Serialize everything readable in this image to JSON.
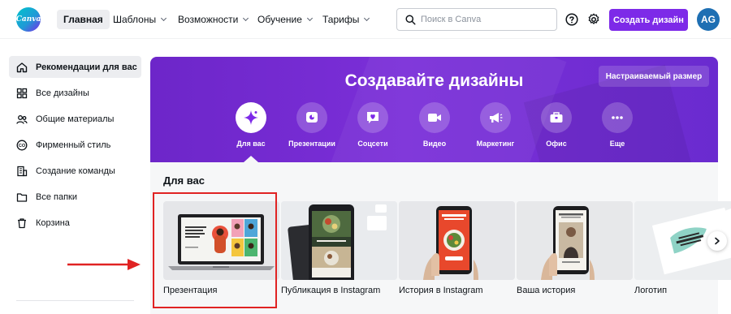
{
  "header": {
    "logo_text": "Canva",
    "nav": [
      {
        "label": "Главная",
        "active": true
      },
      {
        "label": "Шаблоны"
      },
      {
        "label": "Возможности"
      },
      {
        "label": "Обучение"
      },
      {
        "label": "Тарифы"
      }
    ],
    "search_placeholder": "Поиск в Canva",
    "help_icon": "question-circle-icon",
    "settings_icon": "gear-icon",
    "create_button": "Создать дизайн",
    "avatar_initials": "AG"
  },
  "sidebar": {
    "items": [
      {
        "label": "Рекомендации для вас",
        "icon": "home-icon",
        "active": true
      },
      {
        "label": "Все дизайны",
        "icon": "grid-icon"
      },
      {
        "label": "Общие материалы",
        "icon": "people-icon"
      },
      {
        "label": "Фирменный стиль",
        "icon": "brand-icon"
      },
      {
        "label": "Создание команды",
        "icon": "building-icon"
      },
      {
        "label": "Все папки",
        "icon": "folder-icon"
      },
      {
        "label": "Корзина",
        "icon": "trash-icon"
      }
    ]
  },
  "hero": {
    "title": "Создавайте дизайны",
    "custom_size_button": "Настраиваемый размер",
    "categories": [
      {
        "label": "Для вас",
        "icon": "sparkle-icon",
        "active": true
      },
      {
        "label": "Презентации",
        "icon": "presentation-icon"
      },
      {
        "label": "Соцсети",
        "icon": "heart-chat-icon"
      },
      {
        "label": "Видео",
        "icon": "video-camera-icon"
      },
      {
        "label": "Маркетинг",
        "icon": "megaphone-icon"
      },
      {
        "label": "Офис",
        "icon": "briefcase-icon"
      },
      {
        "label": "Еще",
        "icon": "more-dots-icon"
      }
    ]
  },
  "section": {
    "title": "Для вас",
    "cards": [
      {
        "label": "Презентация"
      },
      {
        "label": "Публикация в Instagram"
      },
      {
        "label": "История в Instagram"
      },
      {
        "label": "Ваша история"
      },
      {
        "label": "Логотип"
      }
    ]
  },
  "colors": {
    "accent": "#7d2ae8",
    "annotation_red": "#e02323"
  }
}
